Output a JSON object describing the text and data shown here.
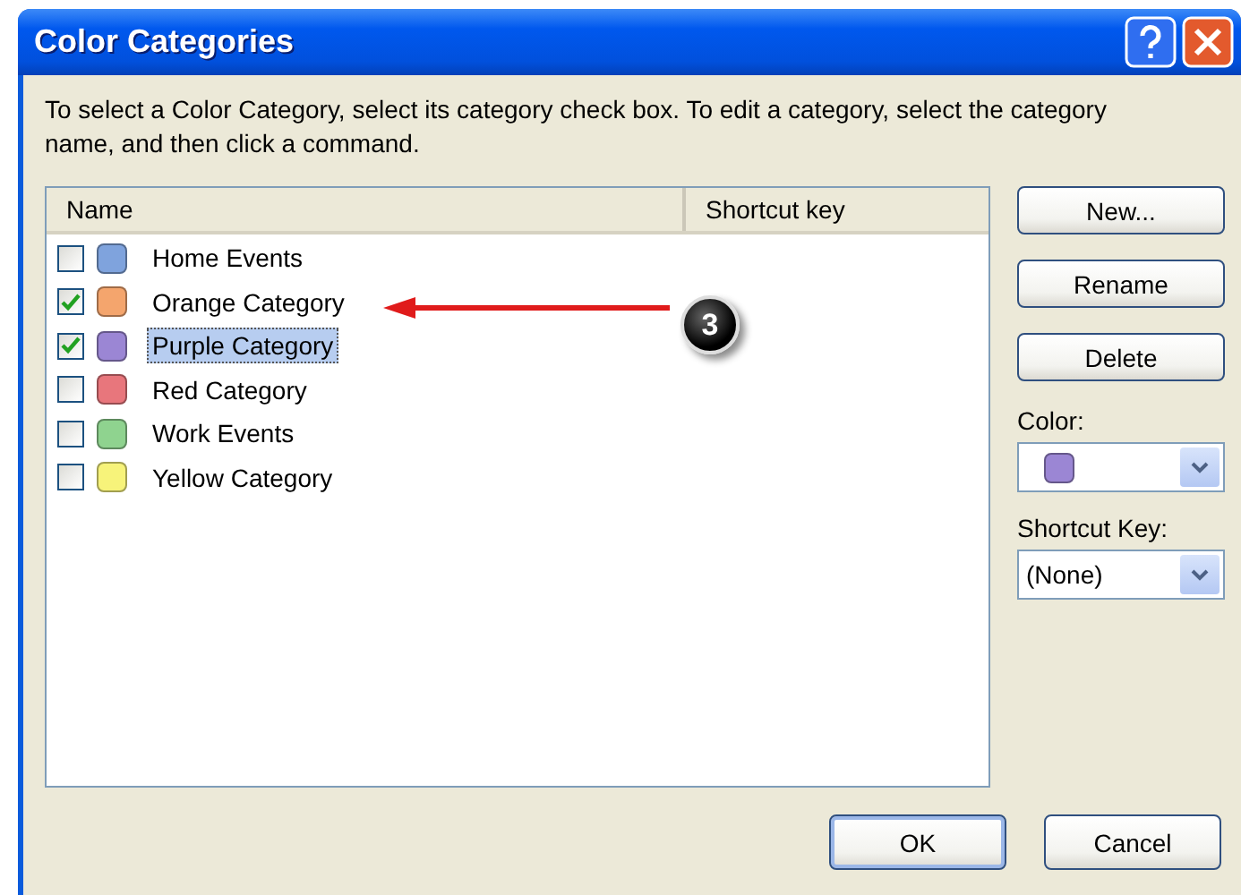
{
  "window": {
    "title": "Color Categories"
  },
  "instructions": "To select a Color Category, select its category check box.  To edit a category, select the category name, and then click a command.",
  "list": {
    "columns": [
      "Name",
      "Shortcut key"
    ],
    "categories": [
      {
        "name": "Home Events",
        "checked": false,
        "selected": false,
        "color": "#7fa3dd"
      },
      {
        "name": "Orange Category",
        "checked": true,
        "selected": false,
        "color": "#f4a56d"
      },
      {
        "name": "Purple Category",
        "checked": true,
        "selected": true,
        "color": "#9b86d4"
      },
      {
        "name": "Red Category",
        "checked": false,
        "selected": false,
        "color": "#e8767c"
      },
      {
        "name": "Work Events",
        "checked": false,
        "selected": false,
        "color": "#8fd38f"
      },
      {
        "name": "Yellow Category",
        "checked": false,
        "selected": false,
        "color": "#f7f37a"
      }
    ]
  },
  "side_buttons": [
    "New...",
    "Rename",
    "Delete"
  ],
  "color_field": {
    "label": "Color:",
    "color": "#9b86d4"
  },
  "shortcut_field": {
    "label": "Shortcut Key:",
    "value": "(None)"
  },
  "annotation": {
    "label": "3"
  },
  "footer_buttons": [
    {
      "label": "OK",
      "default": true
    },
    {
      "label": "Cancel",
      "default": false
    }
  ]
}
